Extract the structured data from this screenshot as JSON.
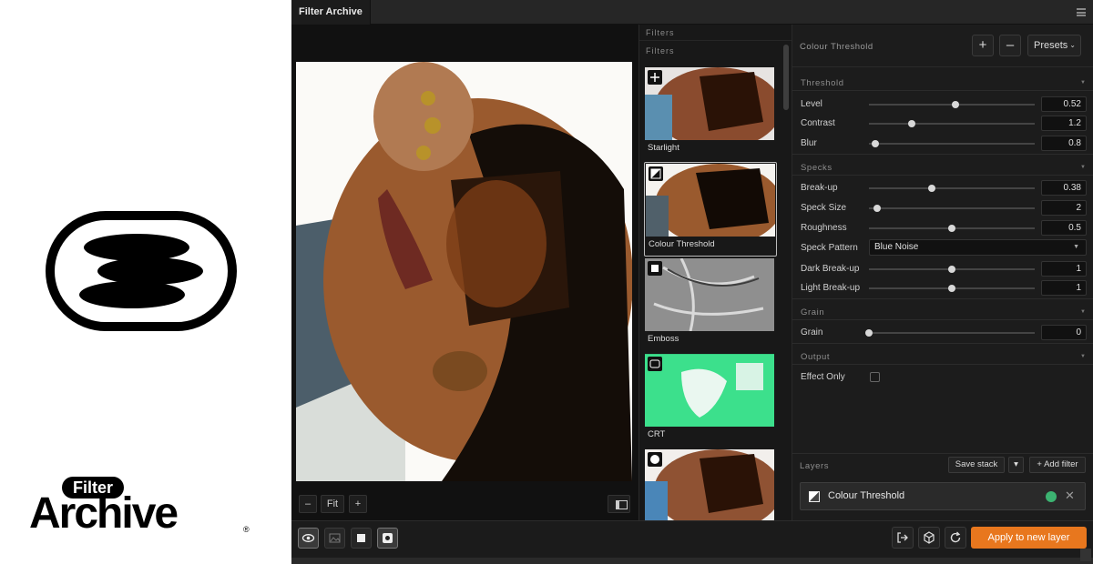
{
  "brand": {
    "filter_word": "Filter",
    "archive_word": "Archive",
    "registered": "®"
  },
  "window": {
    "tab_title": "Filter Archive",
    "menu_icon": "hamburger-icon"
  },
  "canvas": {
    "zoom_out_label": "–",
    "zoom_fit_label": "Fit",
    "zoom_in_label": "+"
  },
  "filters": {
    "header": "Filters",
    "subheader": "Filters",
    "items": [
      {
        "name": "Starlight",
        "icon": "sparkle-icon",
        "selected": false
      },
      {
        "name": "Colour Threshold",
        "icon": "threshold-icon",
        "selected": true
      },
      {
        "name": "Emboss",
        "icon": "emboss-icon",
        "selected": false
      },
      {
        "name": "CRT",
        "icon": "crt-icon",
        "selected": false
      },
      {
        "name": "",
        "icon": "halftone-icon",
        "selected": false
      }
    ]
  },
  "properties": {
    "title": "Colour Threshold",
    "add_label": "+",
    "remove_label": "–",
    "presets_label": "Presets",
    "sections": {
      "threshold": "Threshold",
      "specks": "Specks",
      "grain": "Grain",
      "output": "Output"
    },
    "params": {
      "level": {
        "label": "Level",
        "value": "0.52",
        "fraction": 0.52
      },
      "contrast": {
        "label": "Contrast",
        "value": "1.2",
        "fraction": 0.26
      },
      "blur": {
        "label": "Blur",
        "value": "0.8",
        "fraction": 0.04
      },
      "breakup": {
        "label": "Break-up",
        "value": "0.38",
        "fraction": 0.38
      },
      "speck_size": {
        "label": "Speck Size",
        "value": "2",
        "fraction": 0.05
      },
      "roughness": {
        "label": "Roughness",
        "value": "0.5",
        "fraction": 0.5
      },
      "speck_pattern": {
        "label": "Speck Pattern",
        "value": "Blue Noise"
      },
      "dark_breakup": {
        "label": "Dark Break-up",
        "value": "1",
        "fraction": 0.5
      },
      "light_breakup": {
        "label": "Light Break-up",
        "value": "1",
        "fraction": 0.5
      },
      "grain": {
        "label": "Grain",
        "value": "0",
        "fraction": 0.0
      },
      "effect_only": {
        "label": "Effect Only",
        "checked": false
      }
    }
  },
  "layers": {
    "label": "Layers",
    "save_stack_label": "Save stack",
    "dropdown_label": "▾",
    "add_filter_label": "+ Add filter",
    "items": [
      {
        "name": "Colour Threshold",
        "visible": true,
        "status_color": "#3cb371"
      }
    ]
  },
  "bottom": {
    "apply_label": "Apply to new layer",
    "accent_color": "#e8771e"
  }
}
